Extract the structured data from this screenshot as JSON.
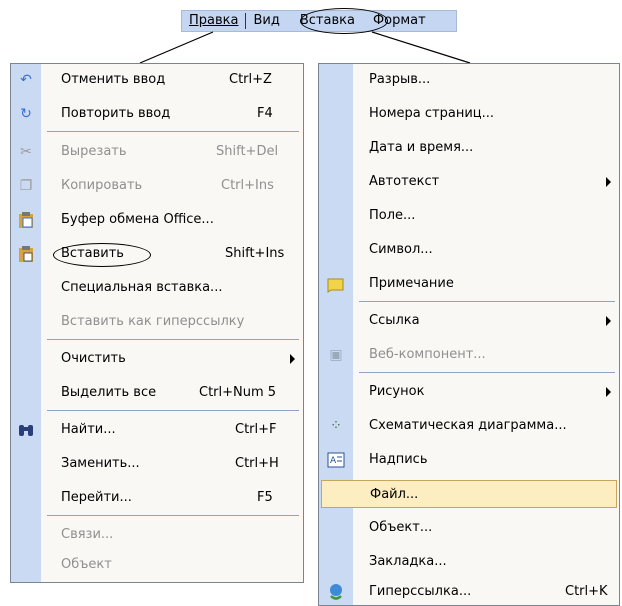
{
  "menubar": {
    "items": [
      "Правка",
      "Вид",
      "Вставка",
      "Формат"
    ]
  },
  "edit_menu": {
    "items": [
      {
        "label": "Отменить ввод",
        "shortcut": "Ctrl+Z",
        "icon": "undo-icon"
      },
      {
        "label": "Повторить ввод",
        "shortcut": "F4",
        "icon": "redo-icon"
      },
      {
        "label": "Вырезать",
        "shortcut": "Shift+Del",
        "icon": "cut-icon"
      },
      {
        "label": "Копировать",
        "shortcut": "Ctrl+Ins",
        "icon": "copy-icon"
      },
      {
        "label": "Буфер обмена Office...",
        "shortcut": "",
        "icon": "clipboard-icon"
      },
      {
        "label": "Вставить",
        "shortcut": "Shift+Ins",
        "icon": "paste-icon"
      },
      {
        "label": "Специальная вставка...",
        "shortcut": ""
      },
      {
        "label": "Вставить как гиперссылку",
        "shortcut": ""
      },
      {
        "label": "Очистить",
        "shortcut": ""
      },
      {
        "label": "Выделить все",
        "shortcut": "Ctrl+Num 5"
      },
      {
        "label": "Найти...",
        "shortcut": "Ctrl+F",
        "icon": "binoculars-icon"
      },
      {
        "label": "Заменить...",
        "shortcut": "Ctrl+H"
      },
      {
        "label": "Перейти...",
        "shortcut": "F5"
      },
      {
        "label": "Связи...",
        "shortcut": ""
      },
      {
        "label": "Объект",
        "shortcut": ""
      }
    ]
  },
  "insert_menu": {
    "items": [
      {
        "label": "Разрыв..."
      },
      {
        "label": "Номера страниц..."
      },
      {
        "label": "Дата и время..."
      },
      {
        "label": "Автотекст"
      },
      {
        "label": "Поле..."
      },
      {
        "label": "Символ..."
      },
      {
        "label": "Примечание",
        "icon": "comment-icon"
      },
      {
        "label": "Ссылка"
      },
      {
        "label": "Веб-компонент...",
        "icon": "web-component-icon"
      },
      {
        "label": "Рисунок"
      },
      {
        "label": "Схематическая диаграмма...",
        "icon": "diagram-icon"
      },
      {
        "label": "Надпись",
        "icon": "text-box-icon"
      },
      {
        "label": "Файл..."
      },
      {
        "label": "Объект..."
      },
      {
        "label": "Закладка..."
      },
      {
        "label": "Гиперссылка...",
        "shortcut": "Ctrl+K",
        "icon": "hyperlink-icon"
      }
    ]
  }
}
